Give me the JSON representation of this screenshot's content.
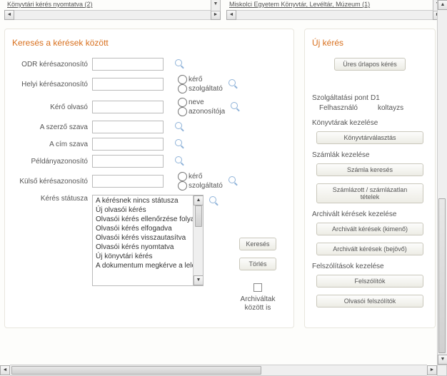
{
  "top": {
    "left_link": "Könyvtári kérés nyomtatva (2)",
    "right_link": "Miskolci Egyetem Könyvtár, Levéltár, Múzeum (1)"
  },
  "search": {
    "title": "Keresés a kérések között",
    "labels": {
      "odr": "ODR kérésazonosító",
      "helyi": "Helyi kérésazonosító",
      "olvaso": "Kérő olvasó",
      "szerzo": "A szerző szava",
      "cim": "A cím szava",
      "peldany": "Példányazonosító",
      "kulso": "Külső kérésazonosító",
      "status": "Kérés státusza"
    },
    "radios": {
      "kero": "kérő",
      "szolgaltato": "szolgáltató",
      "neve": "neve",
      "azonositoja": "azonosítója"
    },
    "status_items": [
      "A kérésnek nincs státusza",
      "Új olvasói kérés",
      "Olvasói kérés ellenőrzése folyamatban",
      "Olvasói kérés elfogadva",
      "Olvasói kérés visszautasítva",
      "Olvasói kérés nyomtatva",
      "Új könyvtári kérés",
      "A dokumentum megkérve a lelőhelyről"
    ],
    "buttons": {
      "kereses": "Keresés",
      "torles": "Törlés"
    },
    "archive_label_l1": "Archiváltak",
    "archive_label_l2": "között is"
  },
  "right": {
    "title": "Új kérés",
    "new_btn": "Üres űrlapos kérés",
    "service_point_k": "Szolgáltatási pont",
    "service_point_v": "D1",
    "user_k": "Felhasználó",
    "user_v": "koltayzs",
    "sections": {
      "konyvtarak": "Könyvtárak kezelése",
      "konyvtarak_btn": "Könyvtárválasztás",
      "szamlak": "Számlák kezelése",
      "szamlak_btn1": "Számla keresés",
      "szamlak_btn2": "Számlázott / számlázatlan tételek",
      "archivalt": "Archivált kérések kezelése",
      "archivalt_btn1": "Archivált kérések (kimenő)",
      "archivalt_btn2": "Archivált kérések (bejövő)",
      "felszol": "Felszólítások kezelése",
      "felszol_btn1": "Felszólítók",
      "felszol_btn2": "Olvasói felszólítók"
    }
  }
}
